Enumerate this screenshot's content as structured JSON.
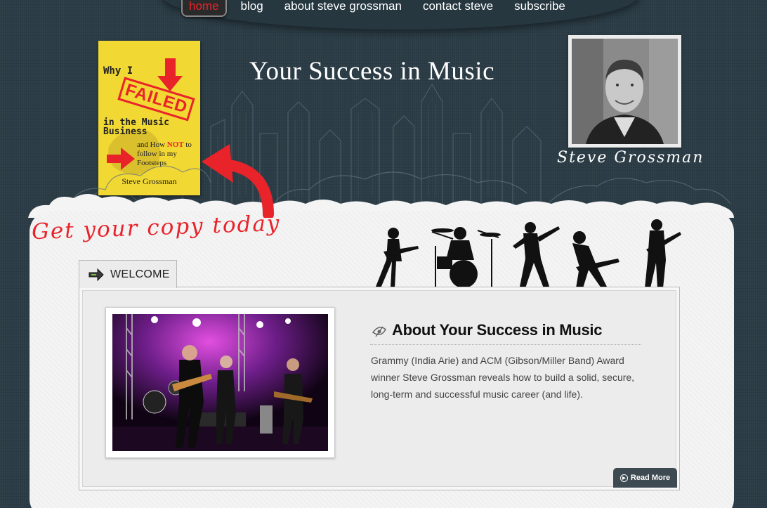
{
  "nav": {
    "items": [
      {
        "label": "home",
        "active": true
      },
      {
        "label": "blog"
      },
      {
        "label": "about steve grossman"
      },
      {
        "label": "contact steve"
      },
      {
        "label": "subscribe"
      }
    ]
  },
  "header": {
    "title": "Your Success in Music",
    "signature": "Steve Grossman",
    "cta": "Get your copy today"
  },
  "book": {
    "line1": "Why I",
    "stamp": "FAILED",
    "line2": "in the Music Business",
    "line3_pre": "and How",
    "line3_red": "NOT",
    "line3_post": "to follow in my Footsteps",
    "author": "Steve Grossman"
  },
  "welcome_tab": {
    "label": "WELCOME"
  },
  "about": {
    "title": "About Your Success in Music",
    "text": "Grammy (India Arie) and ACM (Gibson/Miller Band) Award winner Steve Grossman reveals how to build a solid, secure, long-term and successful music career (and life).",
    "read_more": "Read More"
  },
  "colors": {
    "background": "#2b3c46",
    "accent_red": "#e8232a",
    "book_yellow": "#f2d833",
    "paper": "#f4f4f4",
    "button_dark": "#3e4a52"
  }
}
